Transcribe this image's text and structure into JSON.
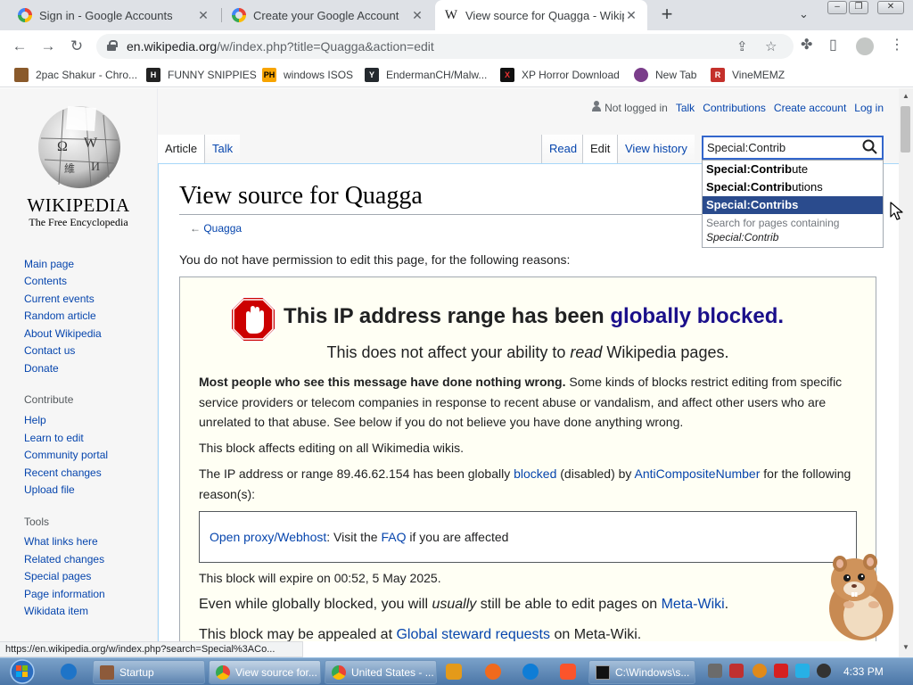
{
  "browser": {
    "tabs": [
      {
        "title": "Sign in - Google Accounts",
        "favicon": "google-icon",
        "active": false
      },
      {
        "title": "Create your Google Account",
        "favicon": "google-icon",
        "active": false
      },
      {
        "title": "View source for Quagga - Wikipe",
        "favicon": "wikipedia-icon",
        "active": true
      }
    ],
    "url_host": "en.wikipedia.org",
    "url_path": "/w/index.php?title=Quagga&action=edit",
    "bookmarks": [
      {
        "label": "2pac Shakur - Chro...",
        "icon": "2pac-icon",
        "color": "#8a5a2b"
      },
      {
        "label": "FUNNY SNIPPIES",
        "icon": "h-icon",
        "color": "#222222"
      },
      {
        "label": "windows ISOS",
        "icon": "ph-icon",
        "color": "#f7a400"
      },
      {
        "label": "EndermanCH/Malw...",
        "icon": "github-icon",
        "color": "#24292e"
      },
      {
        "label": "XP Horror Download",
        "icon": "x-icon",
        "color": "#111111"
      },
      {
        "label": "New Tab",
        "icon": "newtab-icon",
        "color": "#7a3d8a"
      },
      {
        "label": "VineMEMZ",
        "icon": "r-icon",
        "color": "#c4302b"
      }
    ],
    "status_url": "https://en.wikipedia.org/w/index.php?search=Special%3ACo..."
  },
  "wiki": {
    "wordmark": "WIKIPEDIA",
    "tagline": "The Free Encyclopedia",
    "user_links": {
      "not_logged": "Not logged in",
      "talk": "Talk",
      "contributions": "Contributions",
      "create": "Create account",
      "login": "Log in"
    },
    "tabs_left": [
      "Article",
      "Talk"
    ],
    "tabs_right": [
      "Read",
      "Edit",
      "View history"
    ],
    "search": {
      "value": "Special:Contrib",
      "suggestions": [
        {
          "bold": "Special:Contrib",
          "rest": "ute"
        },
        {
          "bold": "Special:Contrib",
          "rest": "utions"
        },
        {
          "bold": "Special:Contribs",
          "rest": ""
        }
      ],
      "footer_line1": "Search for pages containing",
      "footer_line2": "Special:Contrib"
    },
    "nav": {
      "main": [
        "Main page",
        "Contents",
        "Current events",
        "Random article",
        "About Wikipedia",
        "Contact us",
        "Donate"
      ],
      "contribute_heading": "Contribute",
      "contribute": [
        "Help",
        "Learn to edit",
        "Community portal",
        "Recent changes",
        "Upload file"
      ],
      "tools_heading": "Tools",
      "tools": [
        "What links here",
        "Related changes",
        "Special pages",
        "Page information",
        "Wikidata item"
      ]
    },
    "page": {
      "title": "View source for Quagga",
      "back": "Quagga",
      "back_arrow": "←",
      "permission": "You do not have permission to edit this page, for the following reasons:",
      "block_title_plain": "This IP address range has been",
      "block_title_link": "globally blocked.",
      "block_sub_a": "This does not affect your ability to",
      "block_sub_em": "read",
      "block_sub_b": "Wikipedia pages.",
      "p1_bold": "Most people who see this message have done nothing wrong.",
      "p1_rest": "Some kinds of blocks restrict editing from specific service providers or telecom companies in response to recent abuse or vandalism, and affect other users who are unrelated to that abuse. See below if you do not believe you have done anything wrong.",
      "p2": "This block affects editing on all Wikimedia wikis.",
      "p3_a": "The IP address or range 89.46.62.154 has been globally",
      "p3_link1": "blocked",
      "p3_b": "(disabled) by",
      "p3_link2": "AntiCompositeNumber",
      "p3_c": "for the following reason(s):",
      "reason_link": "Open proxy/Webhost",
      "reason_a": ": Visit the",
      "reason_faq": "FAQ",
      "reason_b": "if you are affected",
      "expire": "This block will expire on 00:52, 5 May 2025.",
      "p5_a": "Even while globally blocked, you will",
      "p5_em": "usually",
      "p5_b": "still be able to edit pages on",
      "p5_link": "Meta-Wiki",
      "p6_a": "This block may be appealed at",
      "p6_link": "Global steward requests",
      "p6_b": "on Meta-Wiki."
    }
  },
  "taskbar": {
    "buttons": [
      {
        "label": "Startup",
        "icon": "folder-icon"
      },
      {
        "label": "View source for...",
        "icon": "chrome-icon"
      },
      {
        "label": "United States - ...",
        "icon": "chrome-icon"
      },
      {
        "label": "C:\\Windows\\s...",
        "icon": "cmd-icon"
      }
    ],
    "clock": "4:33 PM"
  }
}
